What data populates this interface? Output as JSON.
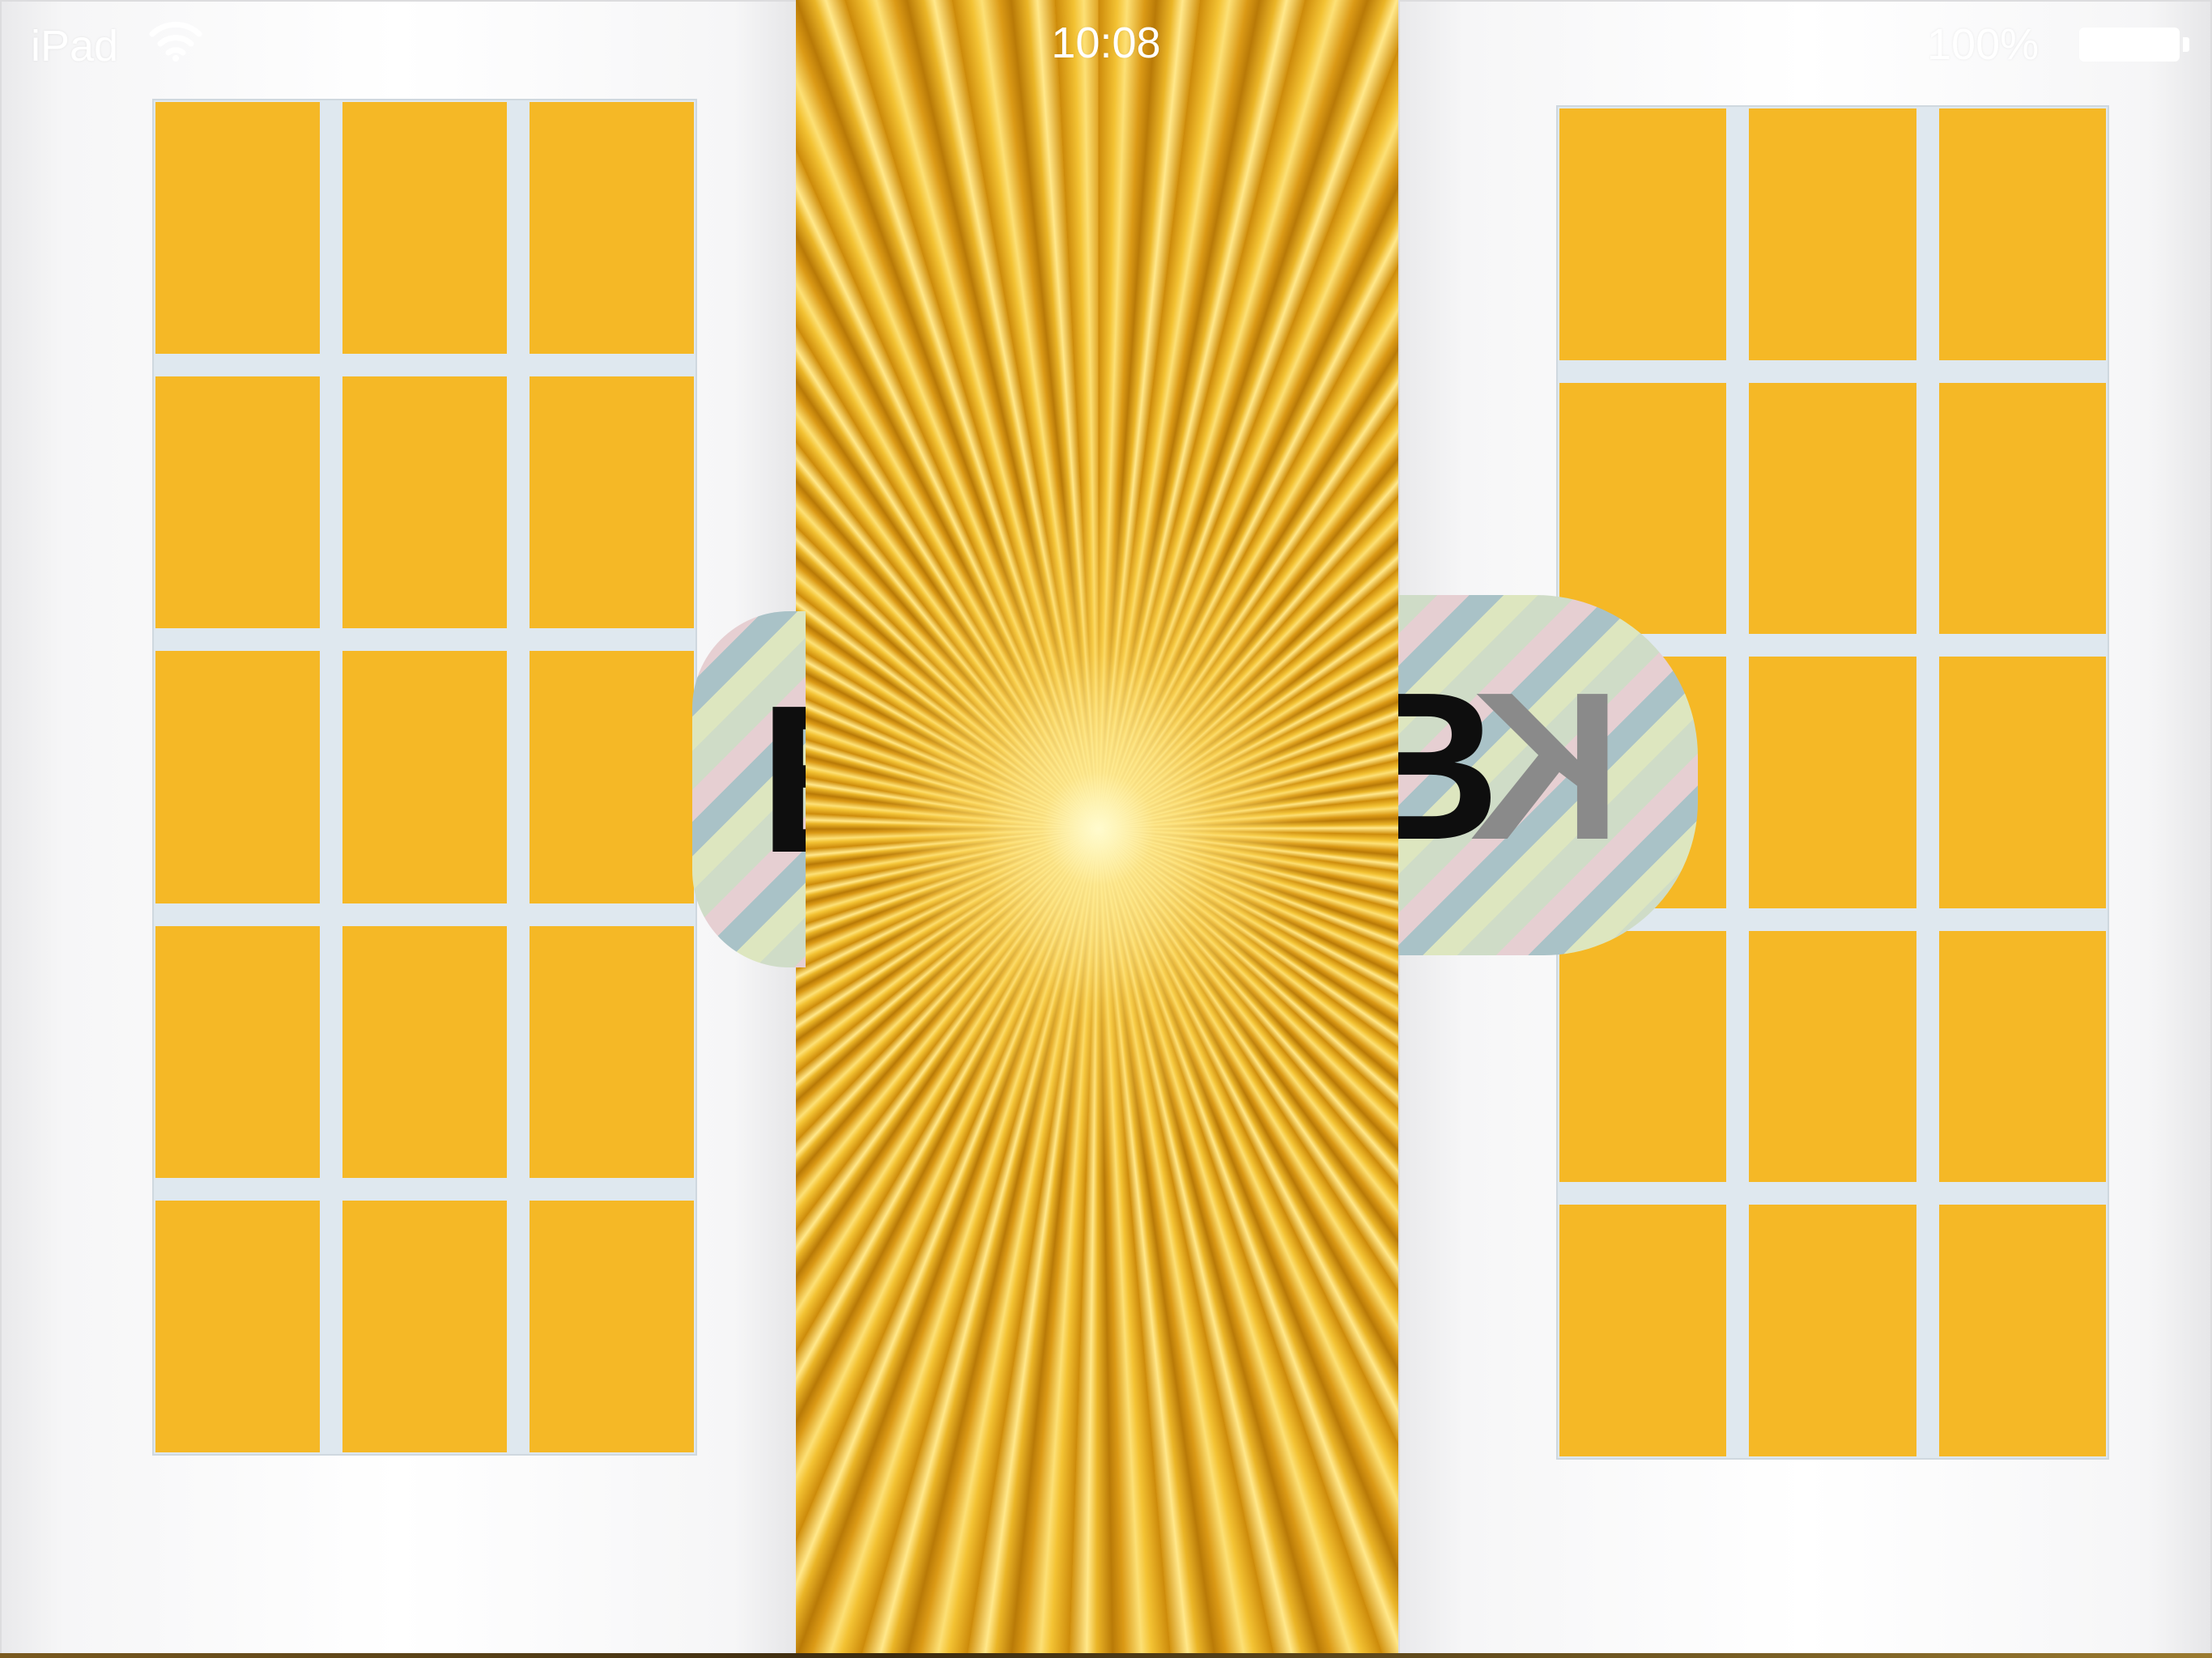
{
  "status_bar": {
    "carrier": "iPad",
    "wifi_icon": "wifi-icon",
    "time": "10:08",
    "battery_percent": "100%",
    "battery_icon": "battery-full-icon"
  },
  "doors": {
    "left_door": {
      "pane_count": 15,
      "pane_color": "#f5b826"
    },
    "right_door": {
      "pane_count": 15,
      "pane_color": "#f5b826"
    }
  },
  "badge": {
    "left_fragment": "B",
    "right_fragment_b": "B",
    "right_fragment_k": "K"
  },
  "colors": {
    "pane": "#f5b826",
    "burst_gold": "#f1c23a",
    "door_white": "#f6f6f7"
  }
}
